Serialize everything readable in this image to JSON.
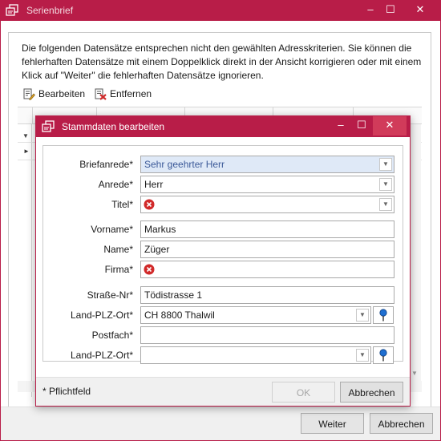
{
  "window": {
    "title": "Serienbrief",
    "minimize_glyph": "–",
    "maximize_glyph": "☐",
    "close_glyph": "✕"
  },
  "info_text": "Die folgenden Datensätze entsprechen nicht den gewählten Adresskriterien. Sie können die fehlerhaften Datensätze mit einem Doppelklick direkt in der Ansicht korrigieren oder mit einem Klick auf \"Weiter\" die fehlerhaften Datensätze ignorieren.",
  "toolbar": {
    "edit_label": "Bearbeiten",
    "remove_label": "Entfernen"
  },
  "grid": {
    "filter_glyph": "▼",
    "row_indicator_glyph": "►",
    "scroll_down_glyph": "▼"
  },
  "footer": {
    "next_label": "Weiter",
    "cancel_label": "Abbrechen"
  },
  "dialog": {
    "title": "Stammdaten bearbeiten",
    "minimize_glyph": "–",
    "maximize_glyph": "☐",
    "close_glyph": "✕",
    "fields": {
      "briefanrede": {
        "label": "Briefanrede*",
        "value": "Sehr geehrter Herr"
      },
      "anrede": {
        "label": "Anrede*",
        "value": "Herr"
      },
      "titel": {
        "label": "Titel*",
        "value": ""
      },
      "vorname": {
        "label": "Vorname*",
        "value": "Markus"
      },
      "name": {
        "label": "Name*",
        "value": "Züger"
      },
      "firma": {
        "label": "Firma*",
        "value": ""
      },
      "strasse": {
        "label": "Straße-Nr*",
        "value": "Tödistrasse 1"
      },
      "land_plz_ort_1": {
        "label": "Land-PLZ-Ort*",
        "value": "CH 8800 Thalwil"
      },
      "postfach": {
        "label": "Postfach*",
        "value": ""
      },
      "land_plz_ort_2": {
        "label": "Land-PLZ-Ort*",
        "value": ""
      }
    },
    "combo_arrow_glyph": "▼",
    "required_note": "* Pflichtfeld",
    "ok_label": "OK",
    "cancel_label": "Abbrechen"
  },
  "colors": {
    "accent": "#b81d48",
    "error": "#d12a2a",
    "pin": "#1f6fd1"
  }
}
